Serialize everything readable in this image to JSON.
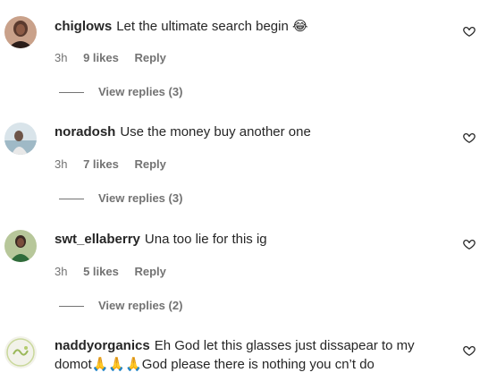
{
  "comments": [
    {
      "username": "chiglows",
      "text": "Let the ultimate search begin",
      "emoji": "😂",
      "time": "3h",
      "likes": "9 likes",
      "reply_label": "Reply",
      "view_replies": "View replies (3)"
    },
    {
      "username": "noradosh",
      "text": "Use the money buy another one",
      "time": "3h",
      "likes": "7 likes",
      "reply_label": "Reply",
      "view_replies": "View replies (3)"
    },
    {
      "username": "swt_ellaberry",
      "text": "Una too lie for this ig",
      "time": "3h",
      "likes": "5 likes",
      "reply_label": "Reply",
      "view_replies": "View replies (2)"
    },
    {
      "username": "naddyorganics",
      "text_line1": "Eh God let this glasses just dissapear to my",
      "text_line2": "domot🙏🙏🙏God please there is nothing you cn’t do"
    }
  ],
  "icons": {
    "like": "heart-outline-icon"
  },
  "colors": {
    "text": "#262626",
    "secondary": "#737373"
  }
}
